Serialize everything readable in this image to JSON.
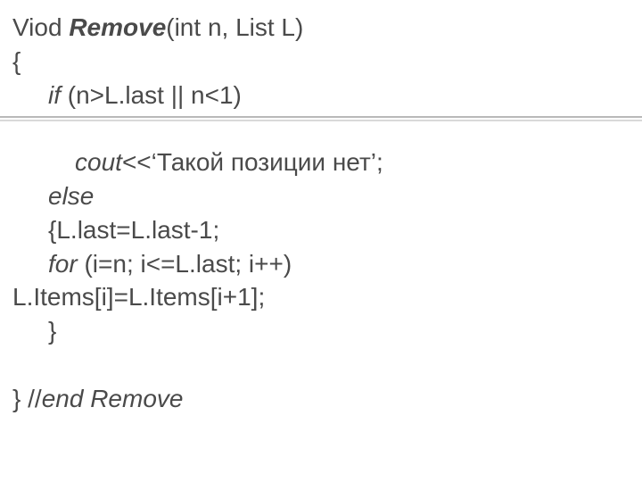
{
  "lines": {
    "l1a": "Viod ",
    "l1b": "Remove",
    "l1c": "(int n, List L)",
    "l2": "{",
    "l3a": "if ",
    "l3b": "(n>L.last || n<1)",
    "l4a": "cout",
    "l4b": "<<‘Такой позиции нет’;",
    "l5": "else",
    "l6": "{L.last=L.last-1;",
    "l7a": "for ",
    "l7b": "(i=n; i<=L.last; i++)",
    "l8": "L.Items[i]=L.Items[i+1];",
    "l9": "}",
    "l10a": "} //",
    "l10b": "end Remove"
  }
}
